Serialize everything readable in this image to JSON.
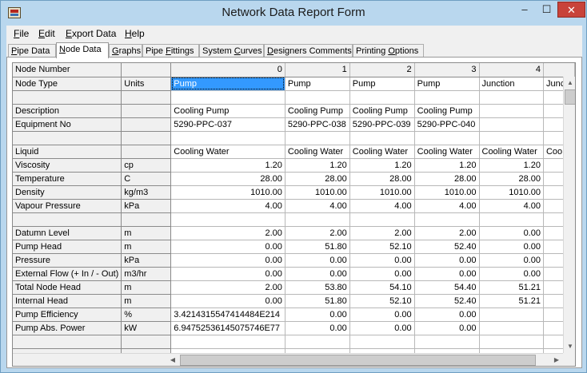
{
  "window": {
    "title": "Network Data Report Form",
    "min_glyph": "–",
    "max_glyph": "☐",
    "close_glyph": "✕"
  },
  "menu": [
    {
      "acc": "F",
      "rest": "ile"
    },
    {
      "acc": "E",
      "rest": "dit"
    },
    {
      "acc": "E",
      "rest": "xport Data"
    },
    {
      "acc": "H",
      "rest": "elp"
    }
  ],
  "tabs": [
    {
      "pre": "",
      "acc": "P",
      "rest": "ipe Data"
    },
    {
      "pre": "",
      "acc": "N",
      "rest": "ode Data"
    },
    {
      "pre": "",
      "acc": "G",
      "rest": "raphs"
    },
    {
      "pre": "Pipe ",
      "acc": "F",
      "rest": "ittings"
    },
    {
      "pre": "System ",
      "acc": "C",
      "rest": "urves"
    },
    {
      "pre": "",
      "acc": "D",
      "rest": "esigners Comments"
    },
    {
      "pre": "Printing ",
      "acc": "O",
      "rest": "ptions"
    }
  ],
  "grid": {
    "corner_label": "Node Number",
    "node_numbers": [
      "0",
      "1",
      "2",
      "3",
      "4"
    ],
    "rows": [
      {
        "label": "Node Type",
        "unit": "Units",
        "values": [
          "Pump",
          "Pump",
          "Pump",
          "Pump",
          "Junction",
          "Junc"
        ],
        "align": "left"
      },
      {
        "label": "",
        "unit": "",
        "values": [
          "",
          "",
          "",
          "",
          "",
          ""
        ],
        "align": "left"
      },
      {
        "label": "Description",
        "unit": "",
        "values": [
          "Cooling Pump",
          "Cooling Pump",
          "Cooling Pump",
          "Cooling Pump",
          "",
          ""
        ],
        "align": "left"
      },
      {
        "label": "Equipment No",
        "unit": "",
        "values": [
          "5290-PPC-037",
          "5290-PPC-038",
          "5290-PPC-039",
          "5290-PPC-040",
          "",
          ""
        ],
        "align": "left"
      },
      {
        "label": "",
        "unit": "",
        "values": [
          "",
          "",
          "",
          "",
          "",
          ""
        ],
        "align": "left"
      },
      {
        "label": "Liquid",
        "unit": "",
        "values": [
          "Cooling Water",
          "Cooling Water",
          "Cooling Water",
          "Cooling Water",
          "Cooling Water",
          "Coo"
        ],
        "align": "left"
      },
      {
        "label": "Viscosity",
        "unit": "cp",
        "values": [
          "1.20",
          "1.20",
          "1.20",
          "1.20",
          "1.20",
          ""
        ],
        "align": "right"
      },
      {
        "label": "Temperature",
        "unit": "C",
        "values": [
          "28.00",
          "28.00",
          "28.00",
          "28.00",
          "28.00",
          ""
        ],
        "align": "right"
      },
      {
        "label": "Density",
        "unit": "kg/m3",
        "values": [
          "1010.00",
          "1010.00",
          "1010.00",
          "1010.00",
          "1010.00",
          ""
        ],
        "align": "right"
      },
      {
        "label": "Vapour Pressure",
        "unit": "kPa",
        "values": [
          "4.00",
          "4.00",
          "4.00",
          "4.00",
          "4.00",
          ""
        ],
        "align": "right"
      },
      {
        "label": "",
        "unit": "",
        "values": [
          "",
          "",
          "",
          "",
          "",
          ""
        ],
        "align": "right"
      },
      {
        "label": "Datumn Level",
        "unit": "m",
        "values": [
          "2.00",
          "2.00",
          "2.00",
          "2.00",
          "0.00",
          ""
        ],
        "align": "right"
      },
      {
        "label": "Pump Head",
        "unit": "m",
        "values": [
          "0.00",
          "51.80",
          "52.10",
          "52.40",
          "0.00",
          ""
        ],
        "align": "right"
      },
      {
        "label": "Pressure",
        "unit": "kPa",
        "values": [
          "0.00",
          "0.00",
          "0.00",
          "0.00",
          "0.00",
          ""
        ],
        "align": "right"
      },
      {
        "label": "External Flow (+ In / - Out)",
        "unit": "m3/hr",
        "values": [
          "0.00",
          "0.00",
          "0.00",
          "0.00",
          "0.00",
          ""
        ],
        "align": "right"
      },
      {
        "label": "Total Node Head",
        "unit": "m",
        "values": [
          "2.00",
          "53.80",
          "54.10",
          "54.40",
          "51.21",
          ""
        ],
        "align": "right"
      },
      {
        "label": "Internal Head",
        "unit": "m",
        "values": [
          "0.00",
          "51.80",
          "52.10",
          "52.40",
          "51.21",
          ""
        ],
        "align": "right"
      },
      {
        "label": "Pump Efficiency",
        "unit": "%",
        "values": [
          "3.4214315547414484E214",
          "0.00",
          "0.00",
          "0.00",
          "",
          ""
        ],
        "align": "right",
        "first_left": true
      },
      {
        "label": "Pump Abs. Power",
        "unit": "kW",
        "values": [
          "6.94752536145075746E77",
          "0.00",
          "0.00",
          "0.00",
          "",
          ""
        ],
        "align": "right",
        "first_left": true
      },
      {
        "label": "",
        "unit": "",
        "values": [
          "",
          "",
          "",
          "",
          "",
          ""
        ],
        "align": "right"
      },
      {
        "label": "",
        "unit": "",
        "values": [
          "",
          "",
          "",
          "",
          "",
          ""
        ],
        "align": "right"
      }
    ]
  },
  "scrollbars": {
    "up_glyph": "▲",
    "down_glyph": "▼",
    "left_glyph": "◀",
    "right_glyph": "▶"
  }
}
